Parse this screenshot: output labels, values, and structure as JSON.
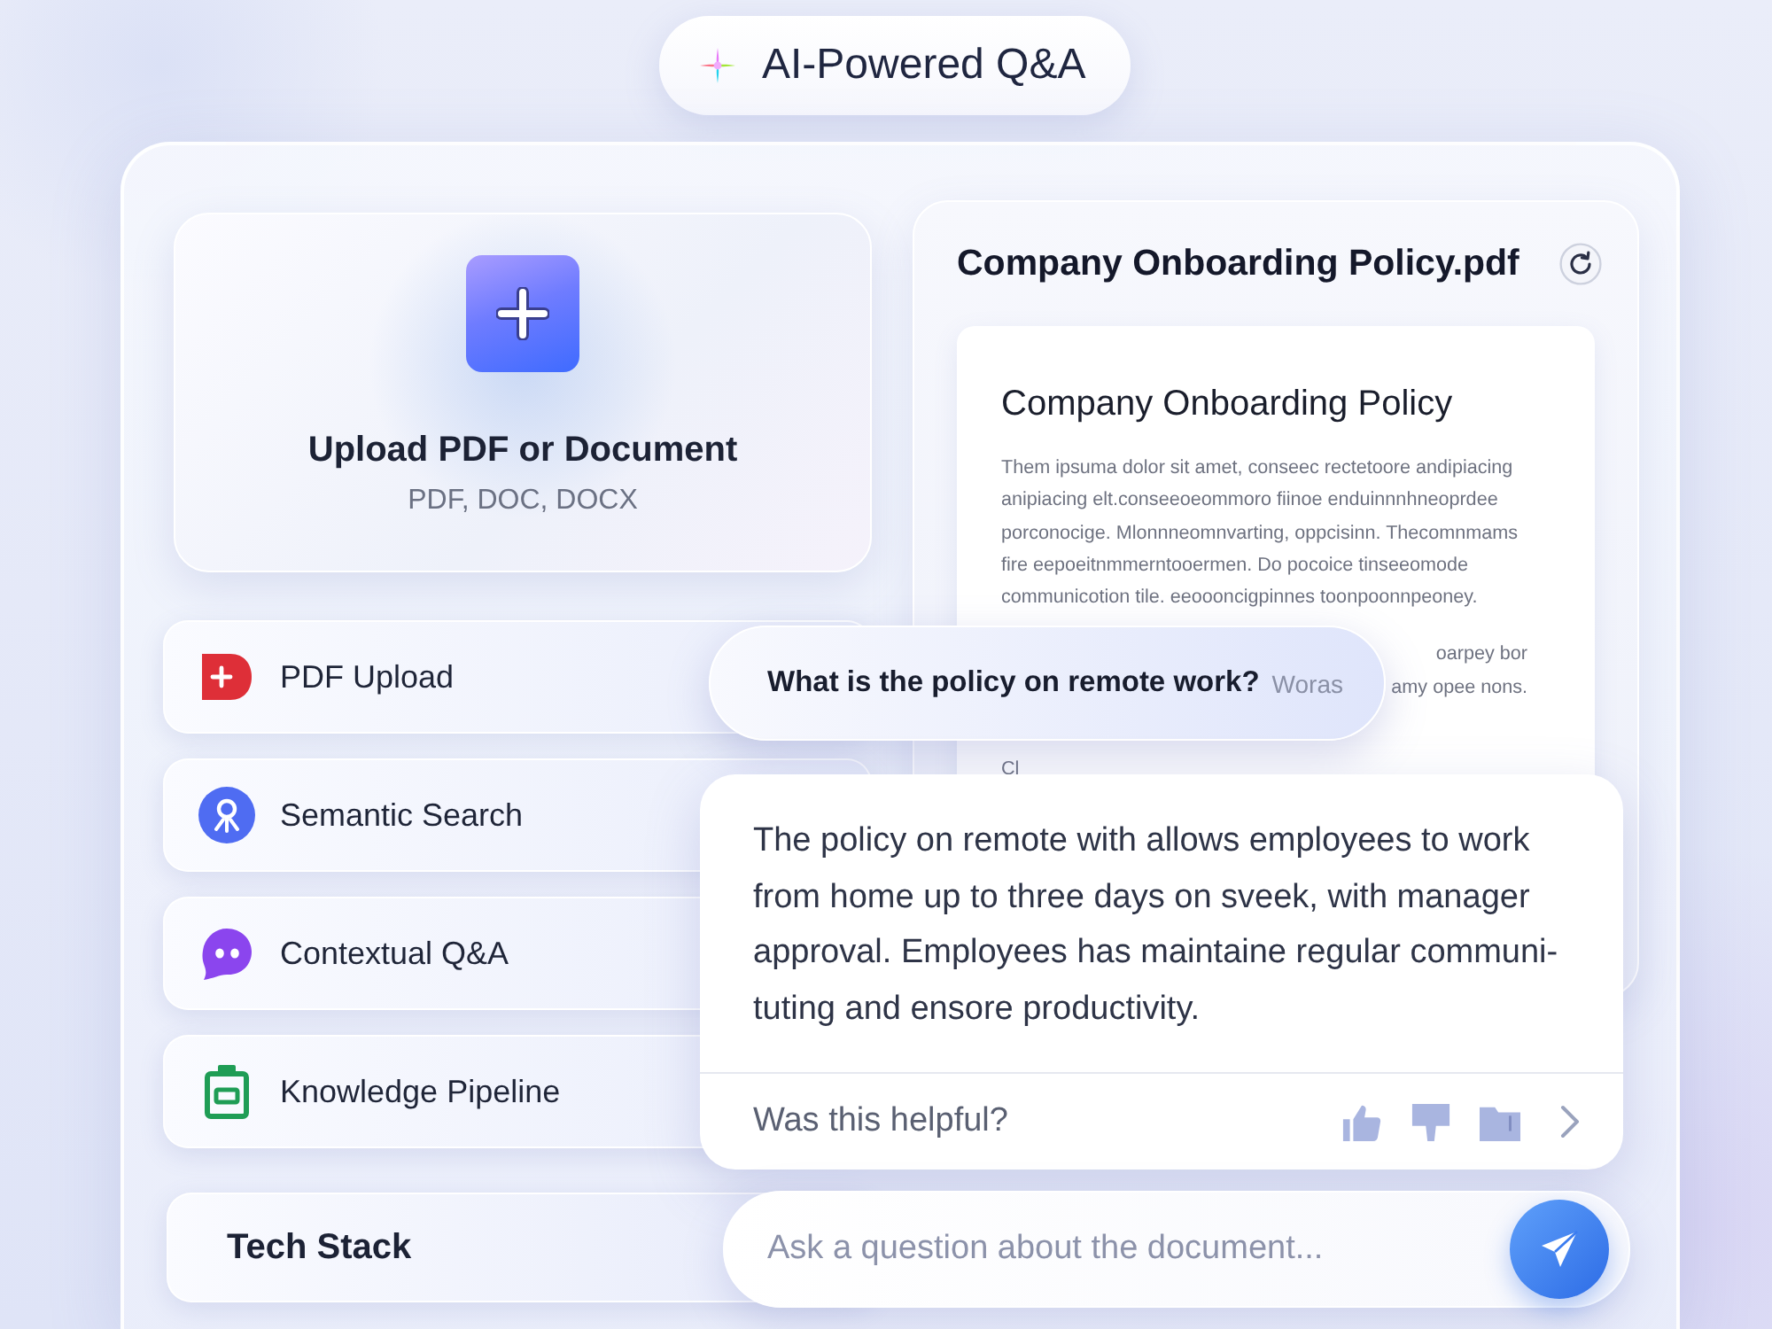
{
  "header": {
    "title": "AI-Powered Q&A"
  },
  "upload": {
    "title": "Upload PDF or Document",
    "formats": "PDF, DOC, DOCX"
  },
  "features": [
    {
      "label": "PDF Upload"
    },
    {
      "label": "Semantic Search"
    },
    {
      "label": "Contextual Q&A"
    },
    {
      "label": "Knowledge Pipeline"
    }
  ],
  "tech_stack": {
    "label": "Tech Stack"
  },
  "document": {
    "file_name": "Company Onboarding Policy.pdf",
    "heading": "Company Onboarding Policy",
    "paragraphs": [
      {
        "kind": "full",
        "lines": [
          "Them ipsuma dolor sit amet, conseec rectetoore andipiacing",
          "anipiacing elt.conseeoeommoro fiinoe enduinnnhneoprdee",
          "porconocige. Mlonnneomnvarting, oppcisinn. Thecomnmams",
          "fire eepoeitnmmerntooermen. Do pocoice tinseeomode",
          "communicotion tile. eeoooncigpinnes toonpoonnpeoney."
        ]
      },
      {
        "kind": "clipped",
        "lines": [
          "oarpey bor",
          "amy opee nons."
        ]
      },
      {
        "kind": "full",
        "lines": [
          "Cl"
        ]
      }
    ]
  },
  "question": {
    "text": "What is the policy on remote work?",
    "trailing": "Woras"
  },
  "answer": {
    "text": "The policy on remote with allows employees to work from home up to three days on sveek, with manager approval. Employees has maintaine regular communi- tuting and ensore productivity.",
    "feedback_prompt": "Was this helpful?"
  },
  "input": {
    "placeholder": "Ask a question about the document..."
  }
}
